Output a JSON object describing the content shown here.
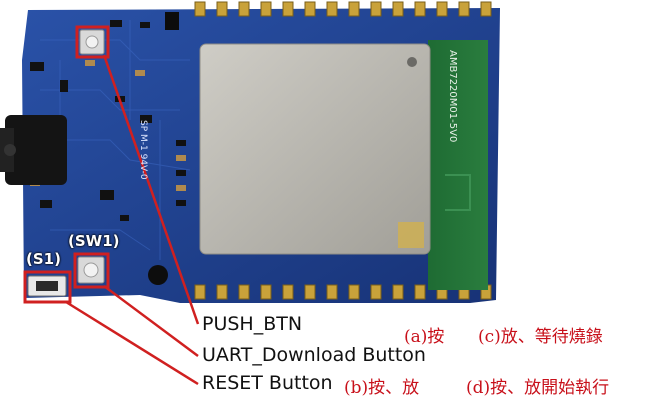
{
  "labels": {
    "push_btn": "PUSH_BTN",
    "uart_download": "UART_Download Button",
    "reset": "RESET Button",
    "sw1": "(SW1)",
    "s1": "(S1)"
  },
  "steps": {
    "a": "(a)按",
    "c": "(c)放、等待燒錄",
    "b": "(b)按、放",
    "d": "(d)按、放開始執行"
  },
  "board": {
    "module_marking": "AMB7220M01-5V0",
    "pcb_marking": "SP M-1 94V-0"
  },
  "colors": {
    "pcb_blue": "#1f3f8f",
    "shield_silver": "#b9b8b2",
    "antenna_green": "#1f6d35",
    "highlight_red": "#d02020",
    "step_text_red": "#c8101a"
  }
}
